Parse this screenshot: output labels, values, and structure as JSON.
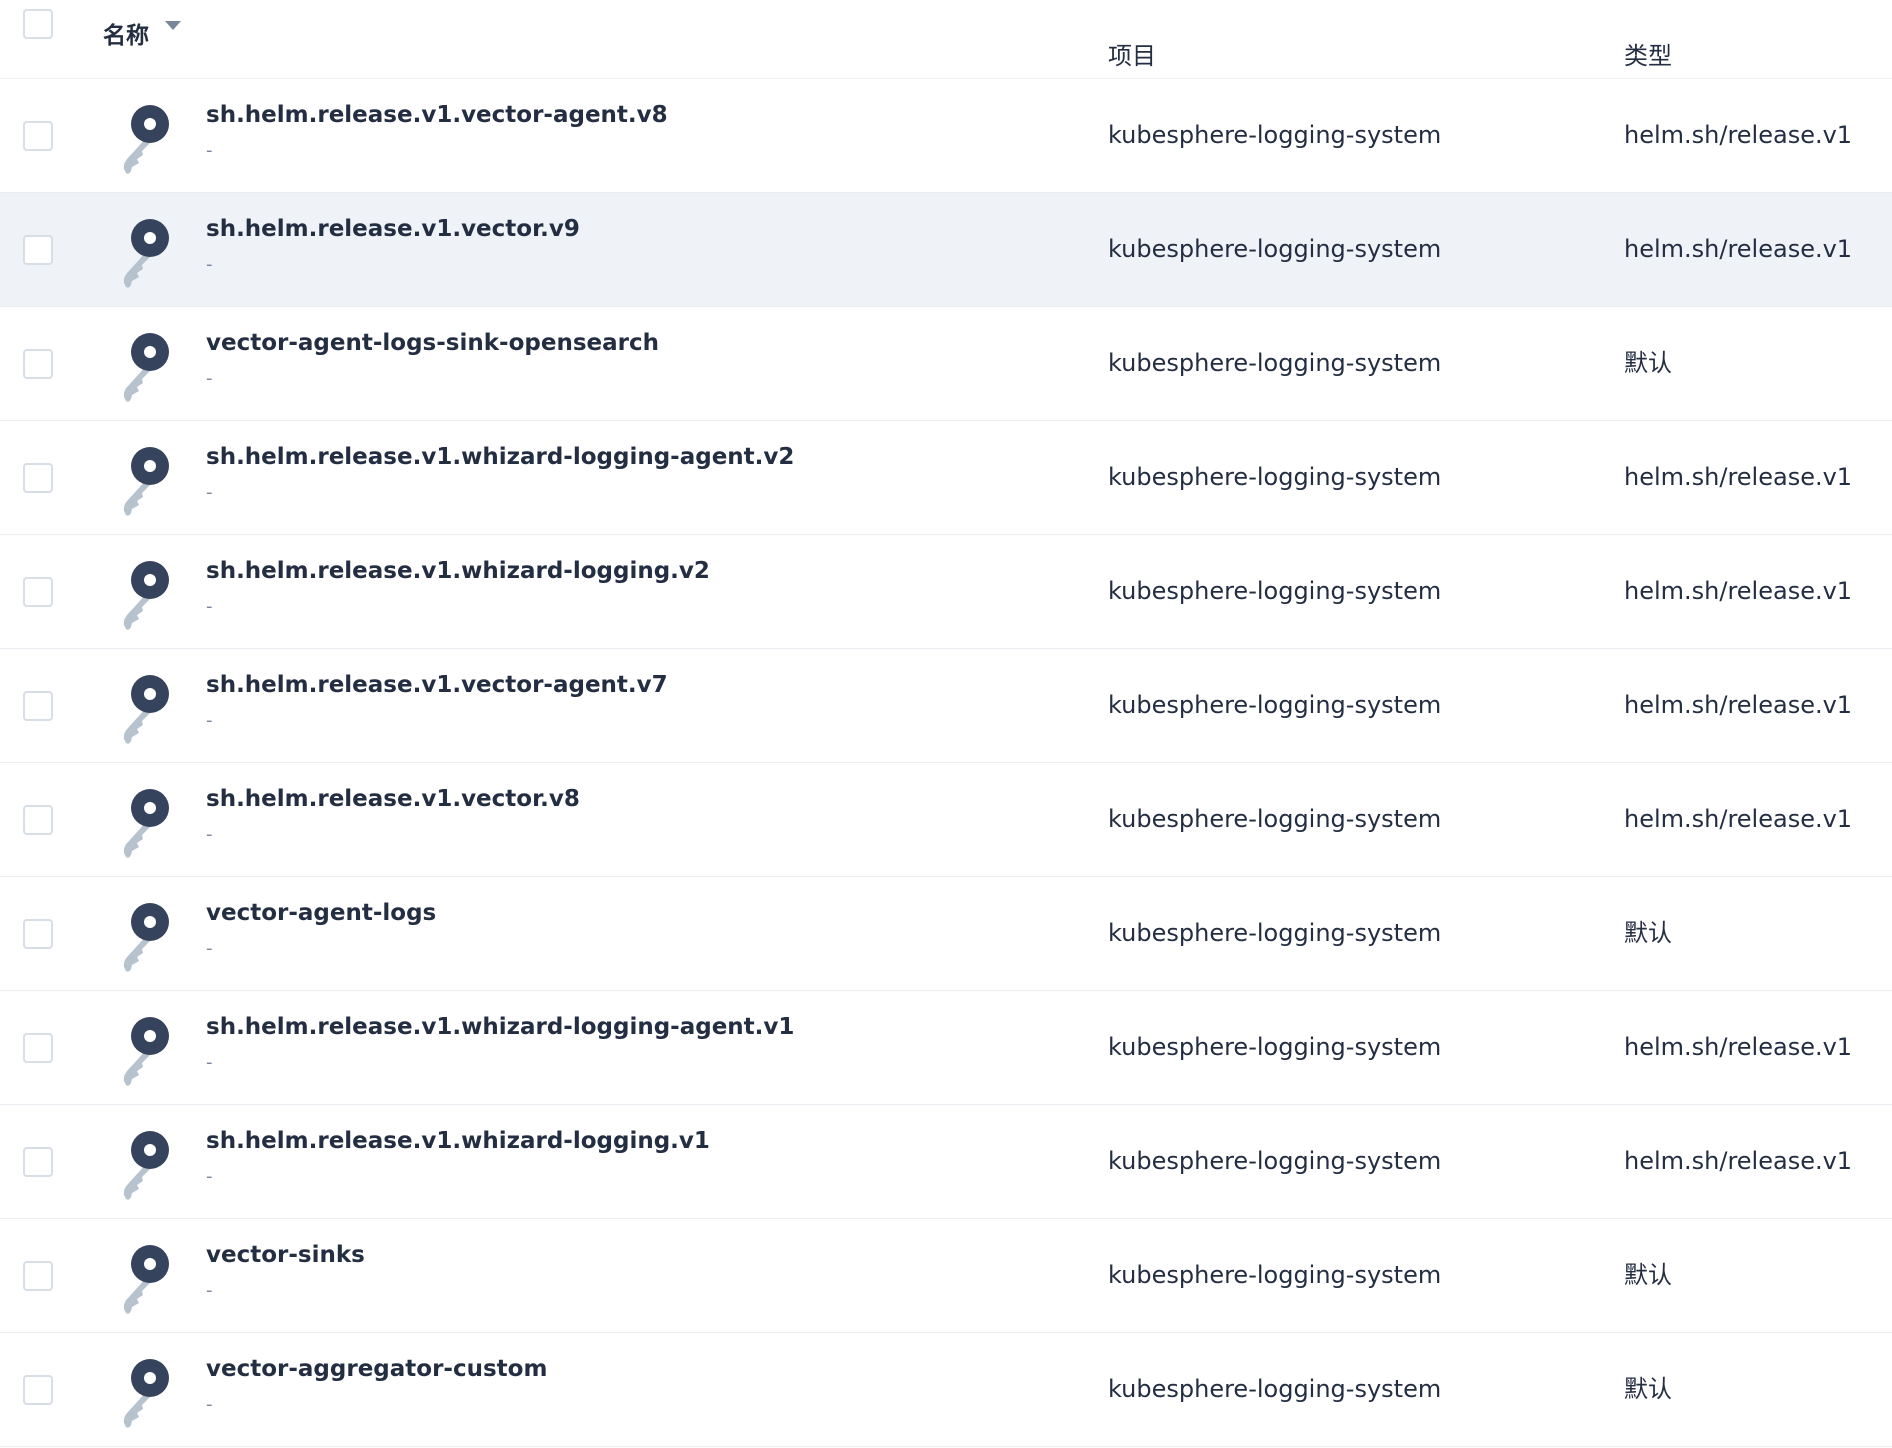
{
  "header": {
    "name_label": "名称",
    "project_label": "项目",
    "type_label": "类型"
  },
  "icons": {
    "row_icon": "key-icon",
    "sort": "caret-down-icon"
  },
  "colors": {
    "icon_dark": "#36435c",
    "icon_light": "#b6c2cd",
    "header_text": "#79879c",
    "text": "#242e42",
    "hover_row": "#eff3f8"
  },
  "rows": [
    {
      "name": "sh.helm.release.v1.vector-agent.v8",
      "description": "-",
      "project": "kubesphere-logging-system",
      "type": "helm.sh/release.v1"
    },
    {
      "name": "sh.helm.release.v1.vector.v9",
      "description": "-",
      "project": "kubesphere-logging-system",
      "type": "helm.sh/release.v1"
    },
    {
      "name": "vector-agent-logs-sink-opensearch",
      "description": "-",
      "project": "kubesphere-logging-system",
      "type": "默认"
    },
    {
      "name": "sh.helm.release.v1.whizard-logging-agent.v2",
      "description": "-",
      "project": "kubesphere-logging-system",
      "type": "helm.sh/release.v1"
    },
    {
      "name": "sh.helm.release.v1.whizard-logging.v2",
      "description": "-",
      "project": "kubesphere-logging-system",
      "type": "helm.sh/release.v1"
    },
    {
      "name": "sh.helm.release.v1.vector-agent.v7",
      "description": "-",
      "project": "kubesphere-logging-system",
      "type": "helm.sh/release.v1"
    },
    {
      "name": "sh.helm.release.v1.vector.v8",
      "description": "-",
      "project": "kubesphere-logging-system",
      "type": "helm.sh/release.v1"
    },
    {
      "name": "vector-agent-logs",
      "description": "-",
      "project": "kubesphere-logging-system",
      "type": "默认"
    },
    {
      "name": "sh.helm.release.v1.whizard-logging-agent.v1",
      "description": "-",
      "project": "kubesphere-logging-system",
      "type": "helm.sh/release.v1"
    },
    {
      "name": "sh.helm.release.v1.whizard-logging.v1",
      "description": "-",
      "project": "kubesphere-logging-system",
      "type": "helm.sh/release.v1"
    },
    {
      "name": "vector-sinks",
      "description": "-",
      "project": "kubesphere-logging-system",
      "type": "默认"
    },
    {
      "name": "vector-aggregator-custom",
      "description": "-",
      "project": "kubesphere-logging-system",
      "type": "默认"
    }
  ]
}
